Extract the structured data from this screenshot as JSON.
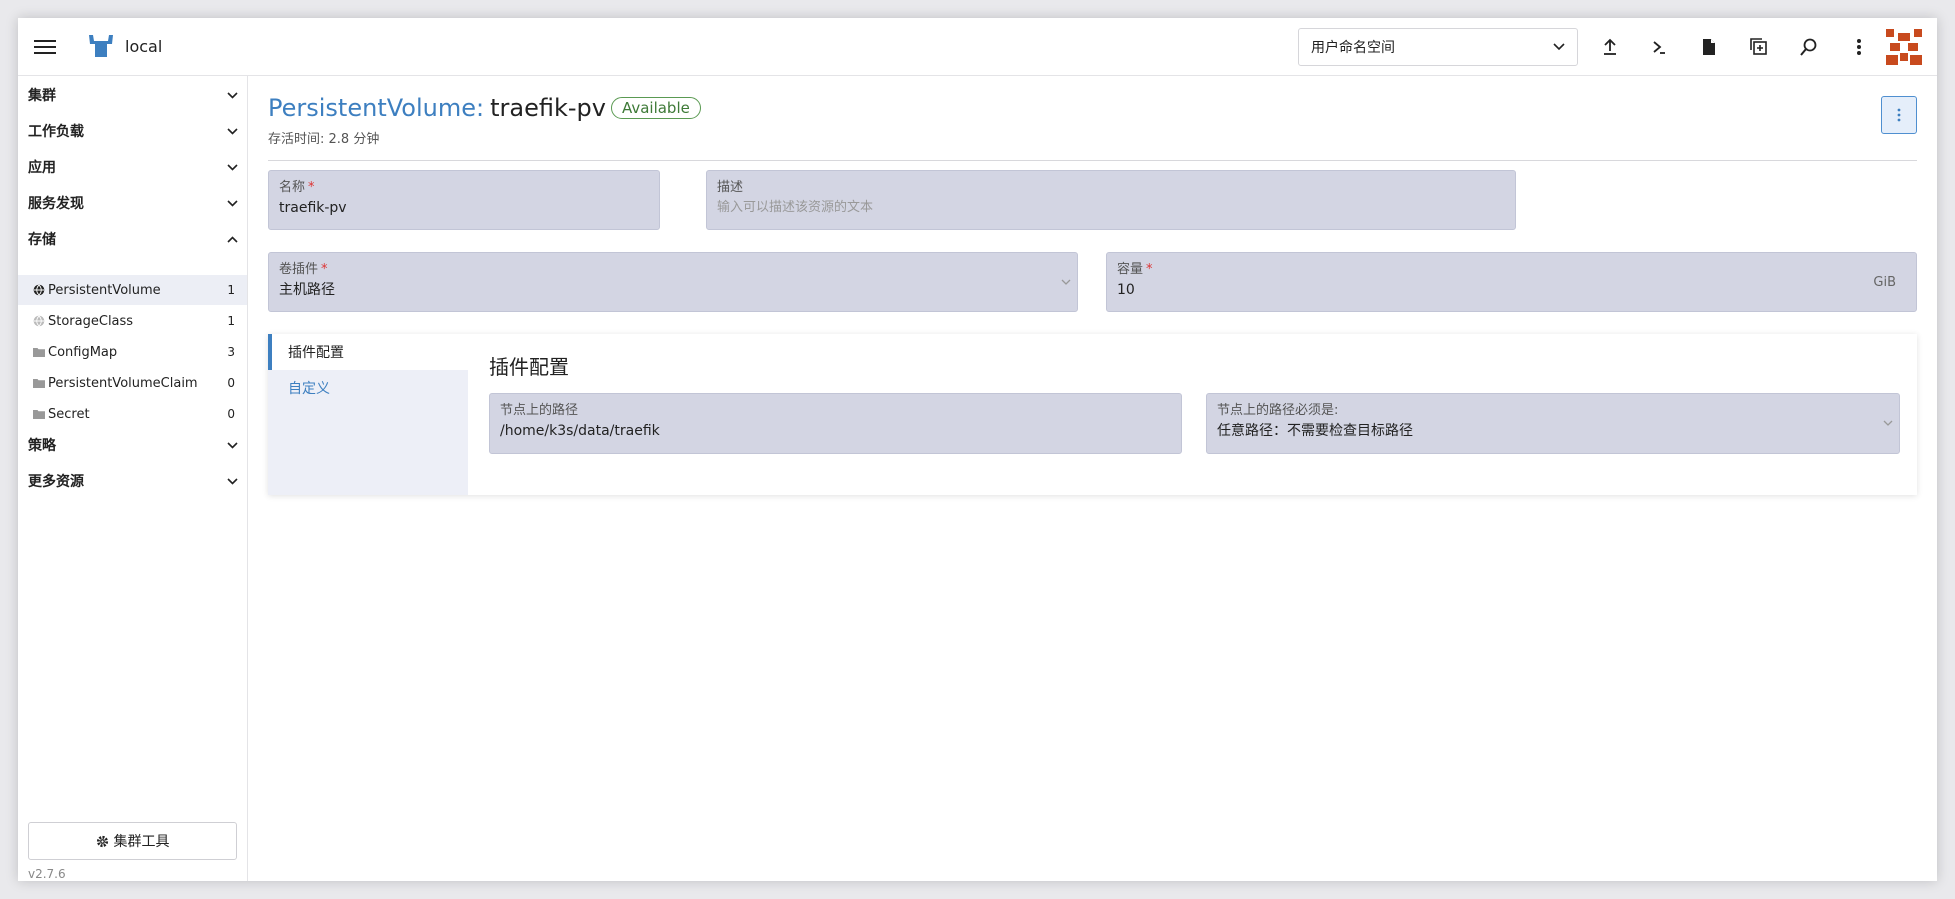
{
  "header": {
    "cluster_name": "local",
    "namespace_select": "用户命名空间",
    "icons": [
      "upload-icon",
      "terminal-icon",
      "file-icon",
      "copy-config-icon",
      "search-icon",
      "more-vertical-icon"
    ]
  },
  "sidebar": {
    "groups": [
      {
        "label": "集群"
      },
      {
        "label": "工作负载"
      },
      {
        "label": "应用"
      },
      {
        "label": "服务发现"
      },
      {
        "label": "存储"
      },
      {
        "label": "策略"
      },
      {
        "label": "更多资源"
      }
    ],
    "storage_items": [
      {
        "label": "PersistentVolume",
        "count": "1",
        "icon": "globe-icon"
      },
      {
        "label": "StorageClass",
        "count": "1",
        "icon": "globe-icon"
      },
      {
        "label": "ConfigMap",
        "count": "3",
        "icon": "folder-icon"
      },
      {
        "label": "PersistentVolumeClaim",
        "count": "0",
        "icon": "folder-icon"
      },
      {
        "label": "Secret",
        "count": "0",
        "icon": "folder-icon"
      }
    ],
    "tools_button": "集群工具",
    "version": "v2.7.6"
  },
  "main": {
    "kind": "PersistentVolume:",
    "name": "traefik-pv",
    "status": "Available",
    "age": "存活时间: 2.8 分钟",
    "fields": {
      "name_label": "名称",
      "name_value": "traefik-pv",
      "desc_label": "描述",
      "desc_placeholder": "输入可以描述该资源的文本",
      "plugin_label": "卷插件",
      "plugin_value": "主机路径",
      "capacity_label": "容量",
      "capacity_value": "10",
      "capacity_unit": "GiB",
      "required_mark": "*"
    },
    "tabs": [
      {
        "label": "插件配置"
      },
      {
        "label": "自定义"
      }
    ],
    "plugin_section": {
      "title": "插件配置",
      "path_label": "节点上的路径",
      "path_value": "/home/k3s/data/traefik",
      "must_be_label": "节点上的路径必须是:",
      "must_be_value": "任意路径：不需要检查目标路径"
    }
  },
  "colors": {
    "accent": "#3d7fc0",
    "field_bg": "#d3d5e3",
    "status_green": "#3e7a37",
    "logo_blue": "#3d7fc0",
    "avatar_orange": "#c84a1e"
  }
}
